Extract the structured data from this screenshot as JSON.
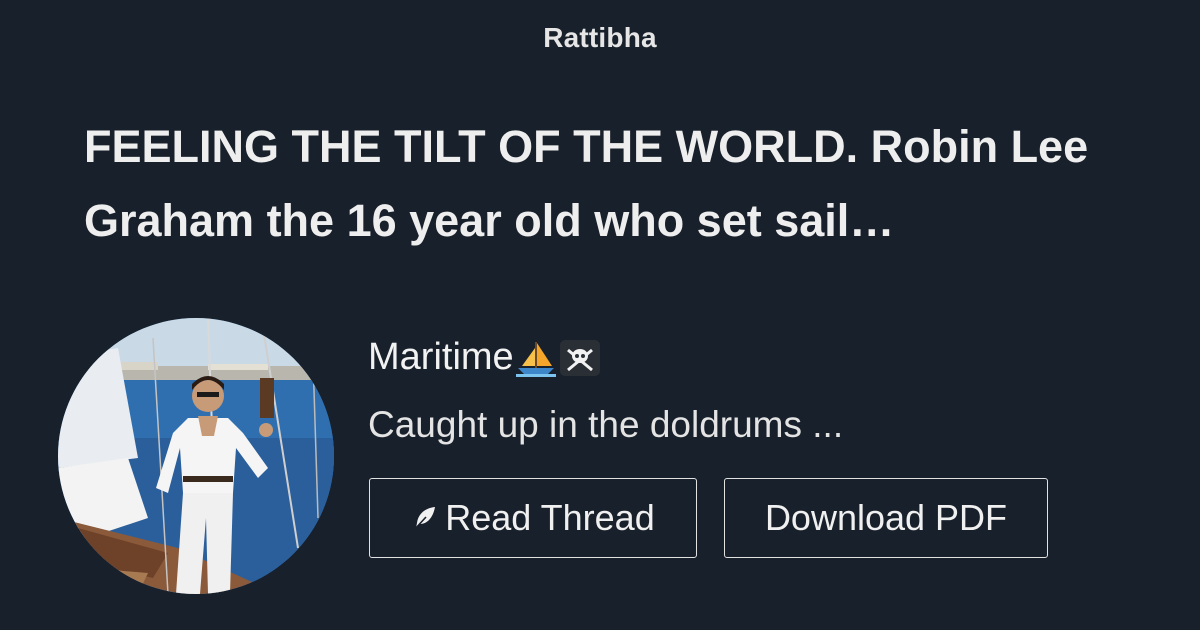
{
  "brand": {
    "name": "Rattibha"
  },
  "thread": {
    "title": "FEELING THE TILT OF THE WORLD. Robin Lee Graham the 16 year old who set sail…",
    "author": "Maritime",
    "author_icons": [
      "sailboat-icon",
      "skull-crossbones-icon"
    ],
    "excerpt": "Caught up in the doldrums ..."
  },
  "actions": {
    "read_label": "Read Thread",
    "read_icon": "feather-icon",
    "pdf_label": "Download PDF"
  },
  "colors": {
    "background": "#18202b",
    "text": "#eeeeee",
    "button_border": "#e2e2e2"
  }
}
